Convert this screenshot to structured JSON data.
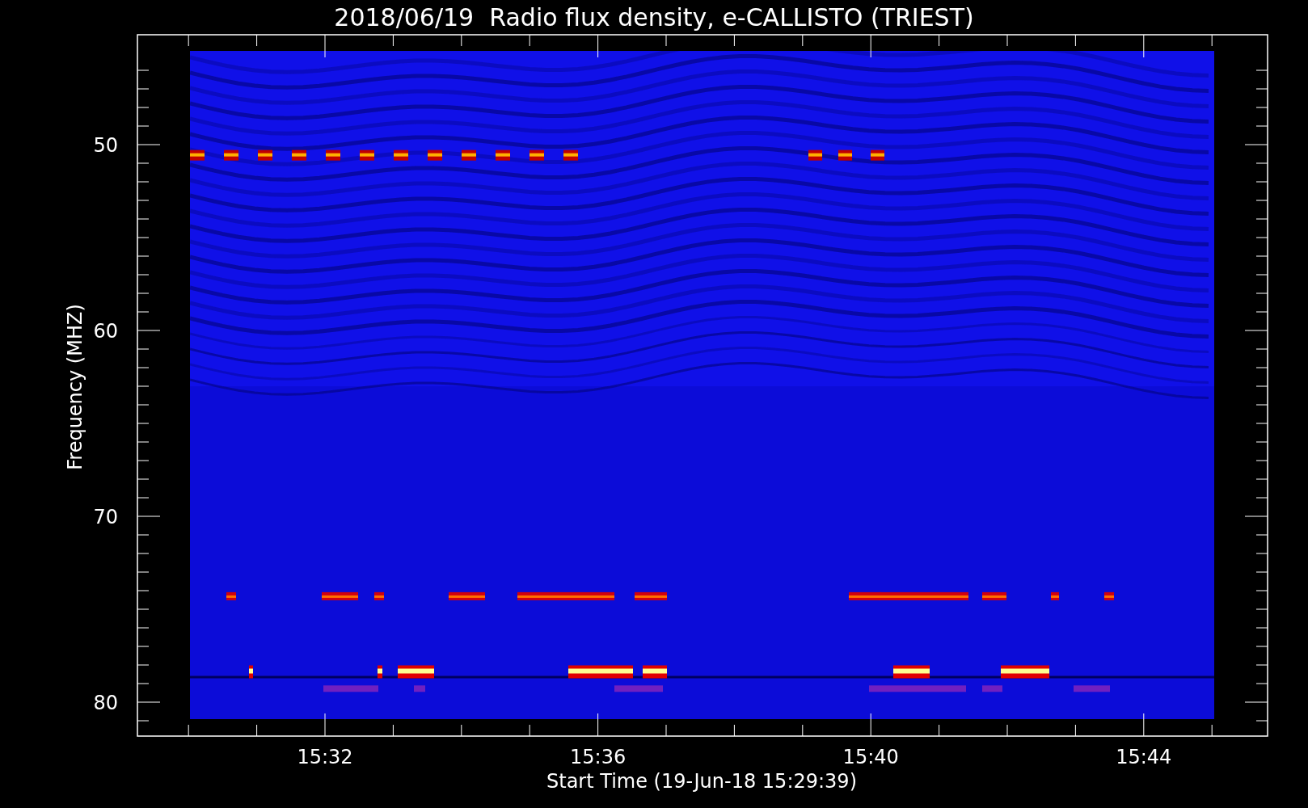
{
  "title": "2018/06/19  Radio flux density, e-CALLISTO (TRIEST)",
  "y_axis": {
    "label": "Frequency (MHZ)",
    "ticks": [
      "50",
      "60",
      "70",
      "80"
    ]
  },
  "x_axis": {
    "label": "Start Time (19-Jun-18 15:29:39)",
    "ticks": [
      "15:32",
      "15:36",
      "15:40",
      "15:44"
    ]
  }
}
